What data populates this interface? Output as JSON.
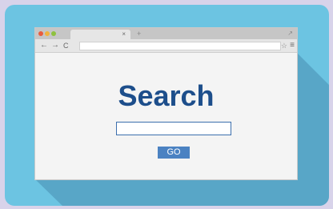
{
  "browser": {
    "tab": {
      "close_icon": "×"
    },
    "new_tab_icon": "+",
    "expand_icon": "↗",
    "nav": {
      "back_icon": "←",
      "forward_icon": "→",
      "reload_icon": "C"
    },
    "address": {
      "value": ""
    },
    "bookmark_icon": "☆",
    "menu_icon": "≡"
  },
  "page": {
    "heading": "Search",
    "search_value": "",
    "go_label": "GO"
  },
  "colors": {
    "background": "#d8d3ea",
    "card": "#6cc4e2",
    "long_shadow": "#58a6c7",
    "heading": "#1d4e8b",
    "go_button": "#4b82c2",
    "close_dot": "#e85c3e",
    "minimize_dot": "#f1b33d",
    "maximize_dot": "#8ec13f"
  }
}
